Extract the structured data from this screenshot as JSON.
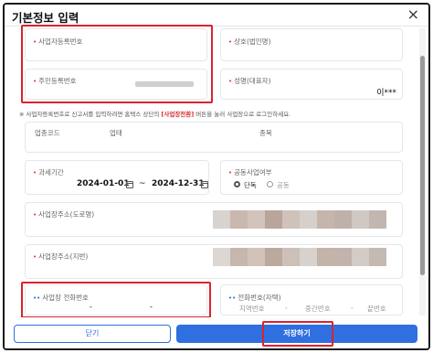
{
  "dialog": {
    "title": "기본정보 입력",
    "close_symbol": "×"
  },
  "fields": {
    "biz_reg_no": {
      "label": "사업자등록번호"
    },
    "company_name": {
      "label": "상호(법인명)"
    },
    "resident_no": {
      "label": "주민등록번호"
    },
    "rep_name": {
      "label": "성명(대표자)",
      "value": "이***"
    },
    "industry_code": {
      "label": "업종코드"
    },
    "business_type": {
      "label": "업태"
    },
    "business_item": {
      "label": "종목"
    },
    "tax_period": {
      "label": "과세기간",
      "start": "2024-01-01",
      "separator": "~",
      "end": "2024-12-31"
    },
    "joint_business": {
      "label": "공동사업여부",
      "options": [
        "단독",
        "공동"
      ],
      "selected": "단독"
    },
    "addr_road": {
      "label": "사업장주소(도로명)"
    },
    "addr_lot": {
      "label": "사업장주소(지번)"
    },
    "biz_phone": {
      "label": "사업장 전화번호",
      "dash1": "-",
      "dash2": "-"
    },
    "home_phone": {
      "label": "전화번호(자택)",
      "area_ph": "지역번호",
      "mid_ph": "중간번호",
      "last_ph": "끝번호",
      "dash1": "-",
      "dash2": "-"
    }
  },
  "notice": {
    "before": "※ 사업자등록번호로 신고서를 입력하려면 홈택스 상단의 ",
    "highlight": "[사업장전환]",
    "after": " 버튼을 눌러 사업장으로 로그인하세요."
  },
  "footer": {
    "close_label": "닫기",
    "save_label": "저장하기"
  },
  "colors": {
    "primary": "#2f6fe0",
    "required_dot": "#e53935",
    "annotation_red": "#d9232e"
  }
}
